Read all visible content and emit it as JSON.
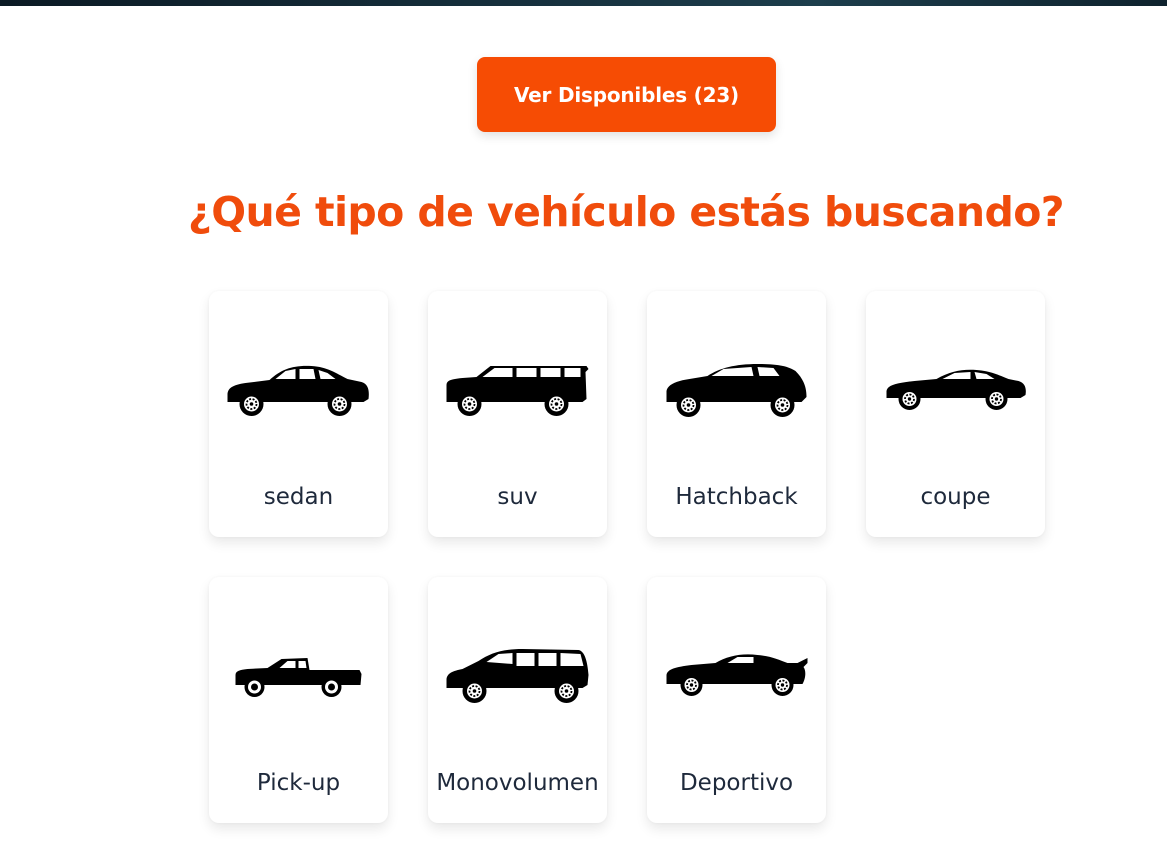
{
  "cta": {
    "label": "Ver Disponibles (23)"
  },
  "heading": {
    "text": "¿Qué tipo de vehículo estás buscando?"
  },
  "vehicle_types": [
    {
      "label": "sedan",
      "icon": "sedan-icon"
    },
    {
      "label": "suv",
      "icon": "suv-icon"
    },
    {
      "label": "Hatchback",
      "icon": "hatchback-icon"
    },
    {
      "label": "coupe",
      "icon": "coupe-icon"
    },
    {
      "label": "Pick-up",
      "icon": "pickup-icon"
    },
    {
      "label": "Monovolumen",
      "icon": "minivan-icon"
    },
    {
      "label": "Deportivo",
      "icon": "sports-car-icon"
    }
  ],
  "colors": {
    "accent": "#f64c04",
    "heading": "#f04c0c",
    "label": "#1e293b"
  }
}
